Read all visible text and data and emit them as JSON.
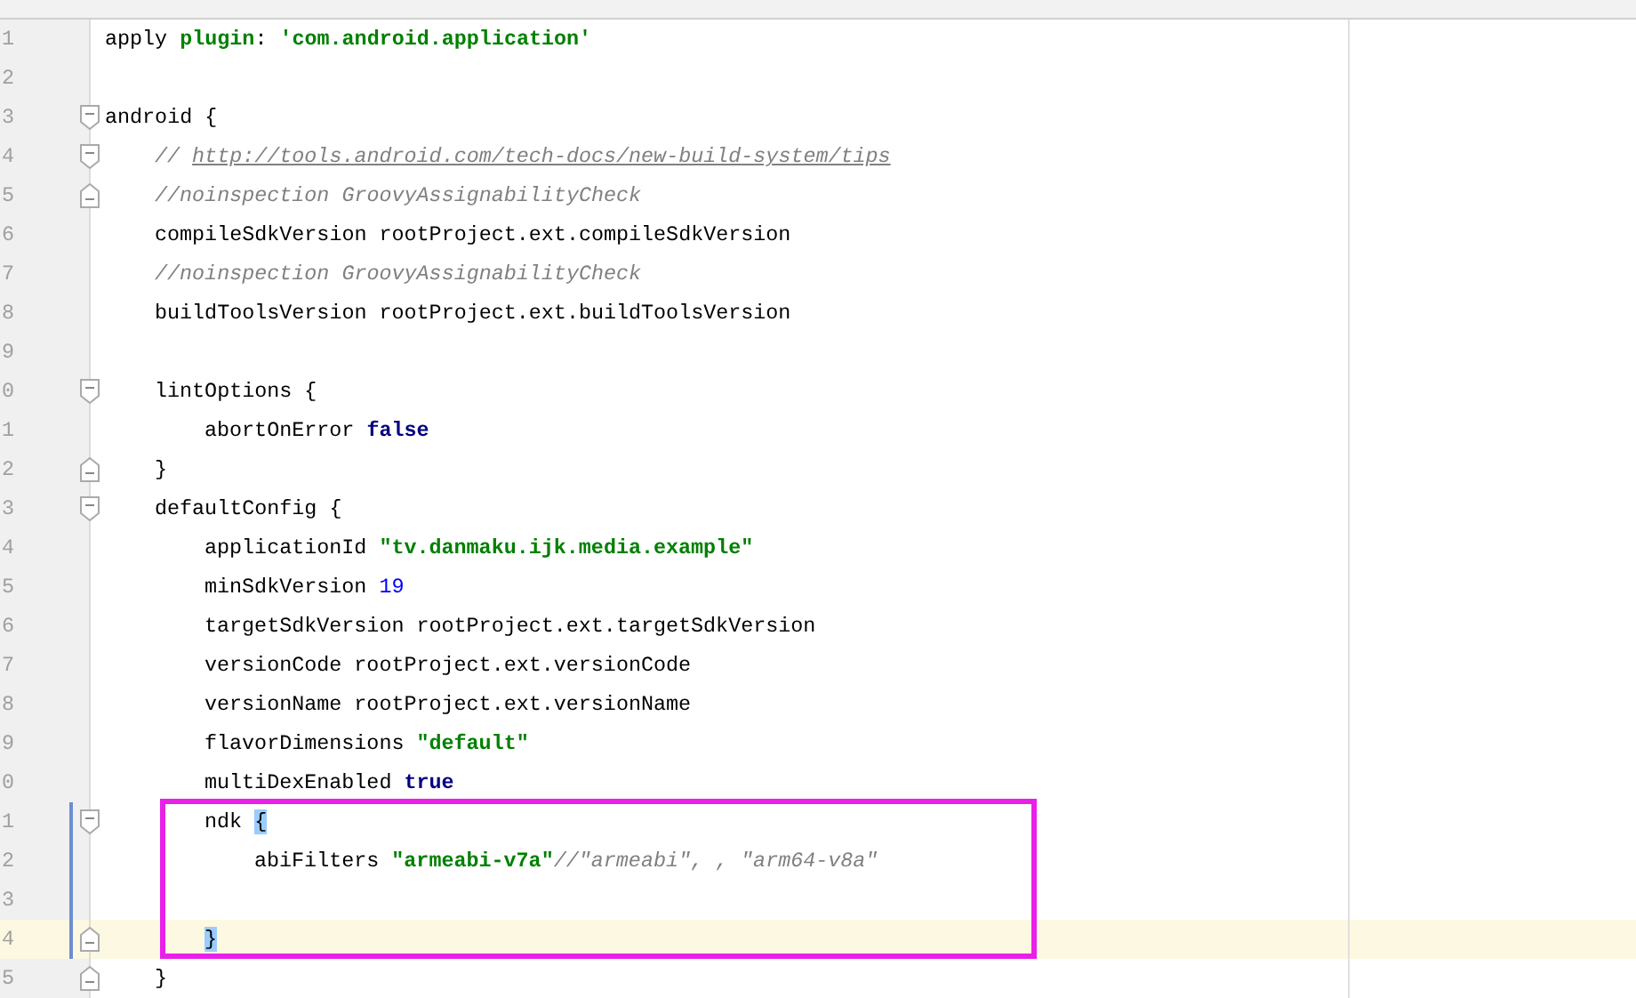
{
  "editor": {
    "lines": [
      {
        "number": "1",
        "fold_start": false,
        "fold_end": false,
        "changed": false,
        "current": false,
        "tokens": [
          {
            "text": "apply ",
            "kind": "plain"
          },
          {
            "text": "plugin",
            "kind": "string"
          },
          {
            "text": ": ",
            "kind": "plain"
          },
          {
            "text": "'com.android.application'",
            "kind": "string"
          }
        ]
      },
      {
        "number": "2",
        "fold_start": false,
        "fold_end": false,
        "changed": false,
        "current": false
      },
      {
        "number": "3",
        "fold_start": true,
        "fold_end": false,
        "changed": false,
        "current": false,
        "tokens": [
          {
            "text": "android {",
            "kind": "plain"
          }
        ],
        "children": [
          {
            "number": "4",
            "fold_start": true,
            "fold_end": false,
            "changed": false,
            "current": false,
            "tokens": [
              {
                "text": "// ",
                "kind": "comment"
              },
              {
                "text": "http://tools.android.com/tech-docs/new-build-system/tips",
                "kind": "link"
              }
            ]
          },
          {
            "number": "5",
            "fold_start": false,
            "fold_end": true,
            "changed": false,
            "current": false,
            "tokens": [
              {
                "text": "//noinspection GroovyAssignabilityCheck",
                "kind": "comment"
              }
            ]
          },
          {
            "number": "6",
            "fold_start": false,
            "fold_end": false,
            "changed": false,
            "current": false,
            "tokens": [
              {
                "text": "compileSdkVersion rootProject.ext.compileSdkVersion",
                "kind": "plain"
              }
            ]
          },
          {
            "number": "7",
            "fold_start": false,
            "fold_end": false,
            "changed": false,
            "current": false,
            "tokens": [
              {
                "text": "//noinspection GroovyAssignabilityCheck",
                "kind": "comment"
              }
            ]
          },
          {
            "number": "8",
            "fold_start": false,
            "fold_end": false,
            "changed": false,
            "current": false,
            "tokens": [
              {
                "text": "buildToolsVersion rootProject.ext.buildToolsVersion",
                "kind": "plain"
              }
            ]
          },
          {
            "number": "9",
            "fold_start": false,
            "fold_end": false,
            "changed": false,
            "current": false
          },
          {
            "number": "0",
            "fold_start": true,
            "fold_end": false,
            "changed": false,
            "current": false,
            "tokens": [
              {
                "text": "lintOptions {",
                "kind": "plain"
              }
            ],
            "children": [
              {
                "number": "1",
                "fold_start": false,
                "fold_end": false,
                "changed": false,
                "current": false,
                "tokens": [
                  {
                    "text": "abortOnError ",
                    "kind": "plain"
                  },
                  {
                    "text": "false",
                    "kind": "keyword"
                  }
                ]
              }
            ]
          },
          {
            "number": "2",
            "fold_start": false,
            "fold_end": true,
            "changed": false,
            "current": false,
            "tokens": [
              {
                "text": "}",
                "kind": "plain"
              }
            ]
          },
          {
            "number": "3",
            "fold_start": true,
            "fold_end": false,
            "changed": false,
            "current": false,
            "tokens": [
              {
                "text": "defaultConfig {",
                "kind": "plain"
              }
            ],
            "children": [
              {
                "number": "4",
                "fold_start": false,
                "fold_end": false,
                "changed": false,
                "current": false,
                "tokens": [
                  {
                    "text": "applicationId ",
                    "kind": "plain"
                  },
                  {
                    "text": "\"tv.danmaku.ijk.media.example\"",
                    "kind": "string"
                  }
                ]
              },
              {
                "number": "5",
                "fold_start": false,
                "fold_end": false,
                "changed": false,
                "current": false,
                "tokens": [
                  {
                    "text": "minSdkVersion ",
                    "kind": "plain"
                  },
                  {
                    "text": "19",
                    "kind": "number"
                  }
                ]
              },
              {
                "number": "6",
                "fold_start": false,
                "fold_end": false,
                "changed": false,
                "current": false,
                "tokens": [
                  {
                    "text": "targetSdkVersion rootProject.ext.targetSdkVersion",
                    "kind": "plain"
                  }
                ]
              },
              {
                "number": "7",
                "fold_start": false,
                "fold_end": false,
                "changed": false,
                "current": false,
                "tokens": [
                  {
                    "text": "versionCode rootProject.ext.versionCode",
                    "kind": "plain"
                  }
                ]
              },
              {
                "number": "8",
                "fold_start": false,
                "fold_end": false,
                "changed": false,
                "current": false,
                "tokens": [
                  {
                    "text": "versionName rootProject.ext.versionName",
                    "kind": "plain"
                  }
                ]
              },
              {
                "number": "9",
                "fold_start": false,
                "fold_end": false,
                "changed": false,
                "current": false,
                "tokens": [
                  {
                    "text": "flavorDimensions ",
                    "kind": "plain"
                  },
                  {
                    "text": "\"default\"",
                    "kind": "string"
                  }
                ]
              },
              {
                "number": "0",
                "fold_start": false,
                "fold_end": false,
                "changed": false,
                "current": false,
                "tokens": [
                  {
                    "text": "multiDexEnabled ",
                    "kind": "plain"
                  },
                  {
                    "text": "true",
                    "kind": "keyword"
                  }
                ]
              },
              {
                "number": "1",
                "fold_start": true,
                "fold_end": false,
                "changed": true,
                "current": false,
                "tokens": [
                  {
                    "text": "ndk ",
                    "kind": "plain"
                  },
                  {
                    "text": "{",
                    "kind": "matched-brace"
                  }
                ],
                "children": [
                  {
                    "number": "2",
                    "fold_start": false,
                    "fold_end": false,
                    "changed": true,
                    "current": false,
                    "tokens": [
                      {
                        "text": "abiFilters ",
                        "kind": "plain"
                      },
                      {
                        "text": "\"armeabi-v7a\"",
                        "kind": "string"
                      },
                      {
                        "text": "//\"armeabi\", , \"arm64-v8a\"",
                        "kind": "comment"
                      }
                    ]
                  },
                  {
                    "number": "3",
                    "fold_start": false,
                    "fold_end": false,
                    "changed": true,
                    "current": false
                  }
                ]
              },
              {
                "number": "4",
                "fold_start": false,
                "fold_end": true,
                "changed": true,
                "current": true,
                "tokens": [
                  {
                    "text": "}",
                    "kind": "matched-brace"
                  }
                ]
              }
            ]
          },
          {
            "number": "5",
            "fold_start": false,
            "fold_end": true,
            "changed": false,
            "current": false,
            "tokens": [
              {
                "text": "}",
                "kind": "plain"
              }
            ]
          }
        ]
      }
    ]
  }
}
